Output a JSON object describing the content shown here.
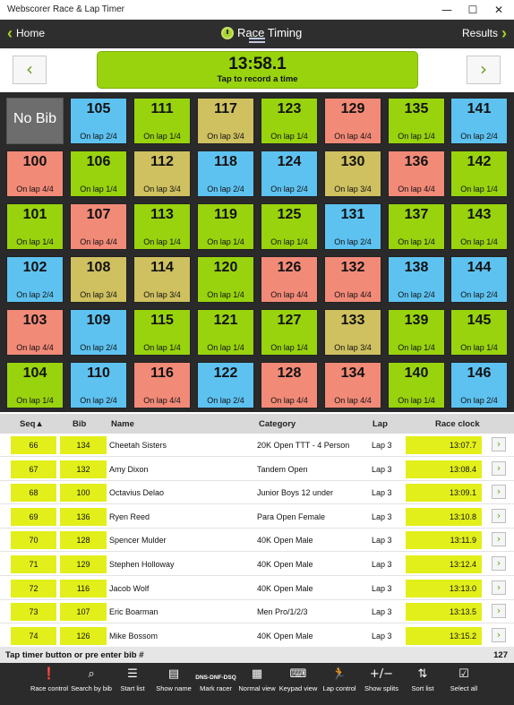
{
  "window": {
    "title": "Webscorer Race & Lap Timer"
  },
  "nav": {
    "home": "Home",
    "title": "Race Timing",
    "results": "Results"
  },
  "timer": {
    "time": "13:58.1",
    "hint": "Tap to record a time"
  },
  "colors": {
    "green": "#98d30e",
    "blue": "#5ec2f0",
    "tan": "#cfc060",
    "salmon": "#f28a78",
    "gray": "#6d6d6d"
  },
  "no_bib_label": "No Bib",
  "bibs": [
    {
      "bib": "105",
      "lap": "On lap 2/4",
      "color": "blue"
    },
    {
      "bib": "111",
      "lap": "On lap 1/4",
      "color": "green"
    },
    {
      "bib": "117",
      "lap": "On lap 3/4",
      "color": "tan"
    },
    {
      "bib": "123",
      "lap": "On lap 1/4",
      "color": "green"
    },
    {
      "bib": "129",
      "lap": "On lap 4/4",
      "color": "salmon"
    },
    {
      "bib": "135",
      "lap": "On lap 1/4",
      "color": "green"
    },
    {
      "bib": "141",
      "lap": "On lap 2/4",
      "color": "blue"
    },
    {
      "bib": "100",
      "lap": "On lap 4/4",
      "color": "salmon"
    },
    {
      "bib": "106",
      "lap": "On lap 1/4",
      "color": "green"
    },
    {
      "bib": "112",
      "lap": "On lap 3/4",
      "color": "tan"
    },
    {
      "bib": "118",
      "lap": "On lap 2/4",
      "color": "blue"
    },
    {
      "bib": "124",
      "lap": "On lap 2/4",
      "color": "blue"
    },
    {
      "bib": "130",
      "lap": "On lap 3/4",
      "color": "tan"
    },
    {
      "bib": "136",
      "lap": "On lap 4/4",
      "color": "salmon"
    },
    {
      "bib": "142",
      "lap": "On lap 1/4",
      "color": "green"
    },
    {
      "bib": "101",
      "lap": "On lap 1/4",
      "color": "green"
    },
    {
      "bib": "107",
      "lap": "On lap 4/4",
      "color": "salmon"
    },
    {
      "bib": "113",
      "lap": "On lap 1/4",
      "color": "green"
    },
    {
      "bib": "119",
      "lap": "On lap 1/4",
      "color": "green"
    },
    {
      "bib": "125",
      "lap": "On lap 1/4",
      "color": "green"
    },
    {
      "bib": "131",
      "lap": "On lap 2/4",
      "color": "blue"
    },
    {
      "bib": "137",
      "lap": "On lap 1/4",
      "color": "green"
    },
    {
      "bib": "143",
      "lap": "On lap 1/4",
      "color": "green"
    },
    {
      "bib": "102",
      "lap": "On lap 2/4",
      "color": "blue"
    },
    {
      "bib": "108",
      "lap": "On lap 3/4",
      "color": "tan"
    },
    {
      "bib": "114",
      "lap": "On lap 3/4",
      "color": "tan"
    },
    {
      "bib": "120",
      "lap": "On lap 1/4",
      "color": "green"
    },
    {
      "bib": "126",
      "lap": "On lap 4/4",
      "color": "salmon"
    },
    {
      "bib": "132",
      "lap": "On lap 4/4",
      "color": "salmon"
    },
    {
      "bib": "138",
      "lap": "On lap 2/4",
      "color": "blue"
    },
    {
      "bib": "144",
      "lap": "On lap 2/4",
      "color": "blue"
    },
    {
      "bib": "103",
      "lap": "On lap 4/4",
      "color": "salmon"
    },
    {
      "bib": "109",
      "lap": "On lap 2/4",
      "color": "blue"
    },
    {
      "bib": "115",
      "lap": "On lap 1/4",
      "color": "green"
    },
    {
      "bib": "121",
      "lap": "On lap 1/4",
      "color": "green"
    },
    {
      "bib": "127",
      "lap": "On lap 1/4",
      "color": "green"
    },
    {
      "bib": "133",
      "lap": "On lap 3/4",
      "color": "tan"
    },
    {
      "bib": "139",
      "lap": "On lap 1/4",
      "color": "green"
    },
    {
      "bib": "145",
      "lap": "On lap 1/4",
      "color": "green"
    },
    {
      "bib": "104",
      "lap": "On lap 1/4",
      "color": "green"
    },
    {
      "bib": "110",
      "lap": "On lap 2/4",
      "color": "blue"
    },
    {
      "bib": "116",
      "lap": "On lap 4/4",
      "color": "salmon"
    },
    {
      "bib": "122",
      "lap": "On lap 2/4",
      "color": "blue"
    },
    {
      "bib": "128",
      "lap": "On lap 4/4",
      "color": "salmon"
    },
    {
      "bib": "134",
      "lap": "On lap 4/4",
      "color": "salmon"
    },
    {
      "bib": "140",
      "lap": "On lap 1/4",
      "color": "green"
    },
    {
      "bib": "146",
      "lap": "On lap 2/4",
      "color": "blue"
    }
  ],
  "table": {
    "headers": {
      "seq": "Seq▲",
      "bib": "Bib",
      "name": "Name",
      "category": "Category",
      "lap": "Lap",
      "clock": "Race clock"
    },
    "rows": [
      {
        "seq": "66",
        "bib": "134",
        "name": "Cheetah Sisters",
        "category": "20K Open TTT - 4 Person",
        "lap": "Lap 3",
        "clock": "13:07.7"
      },
      {
        "seq": "67",
        "bib": "132",
        "name": "Amy Dixon",
        "category": "Tandem Open",
        "lap": "Lap 3",
        "clock": "13:08.4"
      },
      {
        "seq": "68",
        "bib": "100",
        "name": "Octavius Delao",
        "category": "Junior Boys 12 under",
        "lap": "Lap 3",
        "clock": "13:09.1"
      },
      {
        "seq": "69",
        "bib": "136",
        "name": "Ryen Reed",
        "category": "Para Open Female",
        "lap": "Lap 3",
        "clock": "13:10.8"
      },
      {
        "seq": "70",
        "bib": "128",
        "name": "Spencer Mulder",
        "category": "40K Open Male",
        "lap": "Lap 3",
        "clock": "13:11.9"
      },
      {
        "seq": "71",
        "bib": "129",
        "name": "Stephen Holloway",
        "category": "40K Open Male",
        "lap": "Lap 3",
        "clock": "13:12.4"
      },
      {
        "seq": "72",
        "bib": "116",
        "name": "Jacob Wolf",
        "category": "40K Open Male",
        "lap": "Lap 3",
        "clock": "13:13.0"
      },
      {
        "seq": "73",
        "bib": "107",
        "name": "Eric Boarman",
        "category": "Men Pro/1/2/3",
        "lap": "Lap 3",
        "clock": "13:13.5"
      },
      {
        "seq": "74",
        "bib": "126",
        "name": "Mike Bossom",
        "category": "40K Open Male",
        "lap": "Lap 3",
        "clock": "13:15.2"
      }
    ]
  },
  "status": {
    "hint": "Tap timer button or pre enter bib #",
    "count": "127"
  },
  "toolbar": [
    {
      "icon": "alert-icon",
      "glyph": "❗",
      "label": "Race control"
    },
    {
      "icon": "search-icon",
      "glyph": "⌕",
      "label": "Search by bib"
    },
    {
      "icon": "list-icon",
      "glyph": "☰",
      "label": "Start list"
    },
    {
      "icon": "columns-icon",
      "glyph": "▤",
      "label": "Show name"
    },
    {
      "icon": "dns-icon",
      "glyph": "DNS-DNF-DSQ",
      "label": "Mark racer"
    },
    {
      "icon": "grid-icon",
      "glyph": "▦",
      "label": "Normal view"
    },
    {
      "icon": "keypad-icon",
      "glyph": "⌨",
      "label": "Keypad view"
    },
    {
      "icon": "runner-icon",
      "glyph": "🏃",
      "label": "Lap control"
    },
    {
      "icon": "plus-minus-icon",
      "glyph": "+/−",
      "label": "Show splits"
    },
    {
      "icon": "sort-icon",
      "glyph": "⇅",
      "label": "Sort list"
    },
    {
      "icon": "select-all-icon",
      "glyph": "☑",
      "label": "Select all"
    }
  ]
}
